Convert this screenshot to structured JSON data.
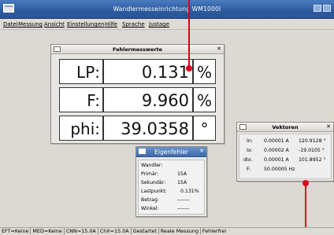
{
  "app": {
    "title": "Wandlermesseinrichtung WM1000I",
    "menu": [
      "Datei",
      "Messung",
      "Ansicht",
      "Einstellungen",
      "Hilfe",
      "Sprache",
      "Justage"
    ]
  },
  "fehlermesswerte": {
    "title": "Fehlermesswerte",
    "rows": [
      {
        "label": "LP:",
        "value": "0.131",
        "unit": "%"
      },
      {
        "label": "F:",
        "value": "9.960",
        "unit": "%"
      },
      {
        "label": "phi:",
        "value": "39.0358",
        "unit": "°"
      }
    ]
  },
  "eigenfehler": {
    "title": "Eigenfehler",
    "rows": [
      {
        "label": "Wandler:",
        "value": ""
      },
      {
        "label": "Primär:",
        "value": "15A"
      },
      {
        "label": "Sekundär:",
        "value": "15A"
      },
      {
        "label": "Lastpunkt:",
        "value": "0.131%"
      },
      {
        "label": "Betrag:",
        "value": "-------"
      },
      {
        "label": "Winkel:",
        "value": "-------"
      }
    ]
  },
  "vektoren": {
    "title": "Vektoren",
    "rows": [
      {
        "label": "In:",
        "amp": "0.00001 A",
        "angle": "120.9128 °"
      },
      {
        "label": "Ix:",
        "amp": "0.00002 A",
        "angle": "-19.0105 °"
      },
      {
        "label": "dIx:",
        "amp": "0.00001 A",
        "angle": "101.8952 °"
      }
    ],
    "freq_label": "F:",
    "freq_value": "50.00005 Hz"
  },
  "status": [
    "EFT=Keine",
    "MED=Keine",
    "CNN=15.0A",
    "ChX=15.0A",
    "Gestartet",
    "Reale Messung",
    "Fehlerfrei"
  ],
  "colors": {
    "titlebar": "#2d5a9e",
    "marker": "#e0001a",
    "workspace": "#dcd9d4"
  }
}
